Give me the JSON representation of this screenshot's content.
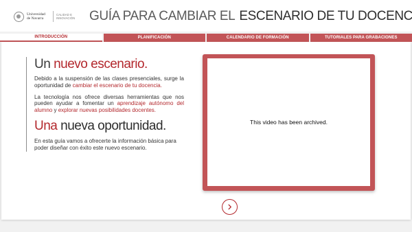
{
  "header": {
    "logo": {
      "name": "Universidad\nde Navarra",
      "sub": "CALIDAD E\nINNOVACIÓN"
    },
    "title_light": "GUÍA PARA CAMBIAR EL",
    "title_bold": "ESCENARIO DE TU DOCENCIA"
  },
  "tabs": [
    {
      "label": "INTRODUCCIÓN",
      "active": true
    },
    {
      "label": "PLANIFICACIÓN",
      "active": false
    },
    {
      "label": "CALENDARIO DE FORMACIÓN",
      "active": false
    },
    {
      "label": "TUTORIALES PARA GRABACIONES",
      "active": false
    }
  ],
  "content": {
    "heading1": {
      "lead": "Un",
      "emph": "nuevo escenario."
    },
    "para1": {
      "text": "Debido a la suspensión de las clases presenciales, surge la oportunidad de",
      "link": "cambiar el escenario de tu docencia."
    },
    "para2": {
      "text_a": "La tecnología nos ofrece diversas herramientas que nos pueden ayudar a fomentar un",
      "link_a": "aprendizaje autónomo del alumno",
      "text_b": "y",
      "link_b": "explorar nuevas posibilidades docentes."
    },
    "heading2": {
      "lead": "Una",
      "emph": "nueva oportunidad."
    },
    "para3": "En esta guía vamos a ofrecerte la información básica para poder diseñar con éxito este nuevo escenario."
  },
  "video": {
    "message": "This video has been archived."
  },
  "icons": {
    "next": "chevron-right-icon",
    "logo": "university-seal-icon"
  },
  "colors": {
    "accent": "#c25457",
    "accent_dark": "#b3282d"
  }
}
